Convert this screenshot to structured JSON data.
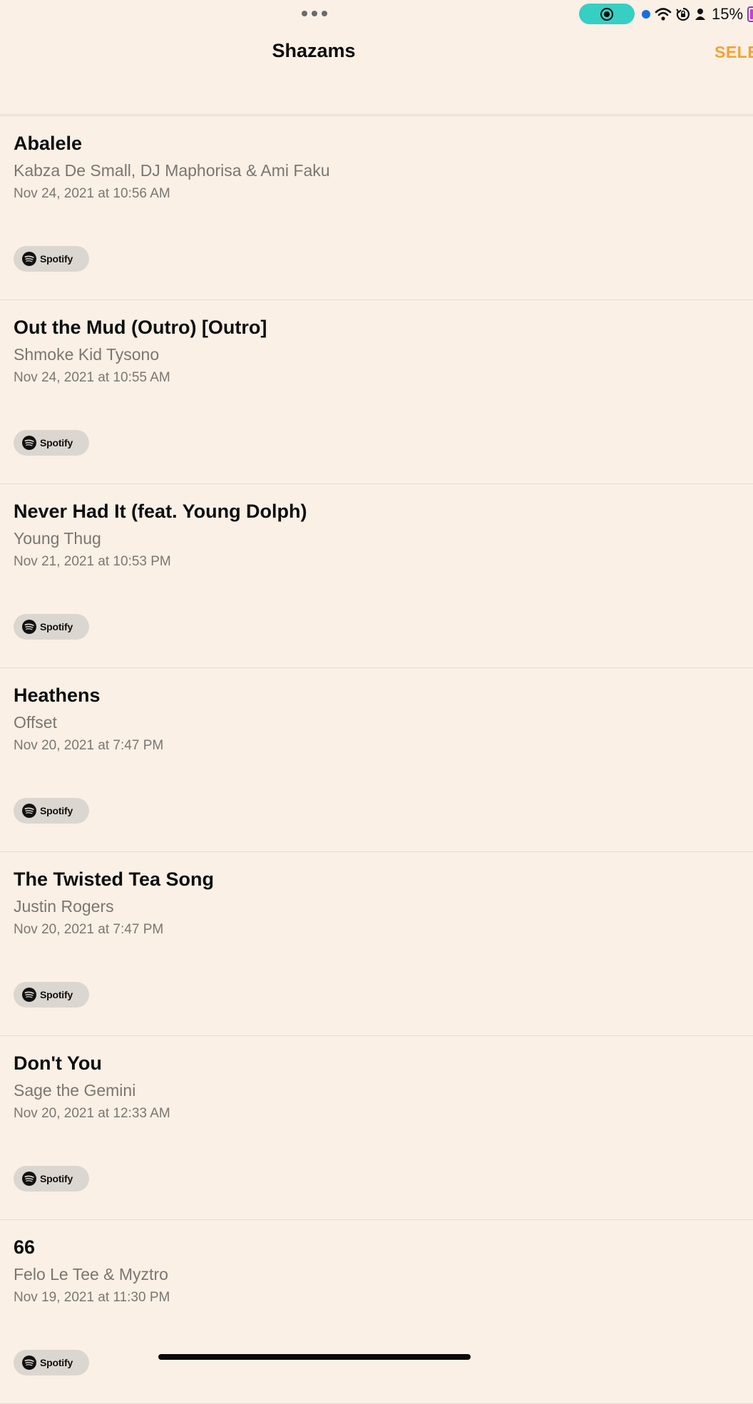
{
  "status_bar": {
    "battery_percent": "15%",
    "icons": [
      "multitask-dots-icon",
      "screen-record-icon",
      "location-dot-icon",
      "wifi-icon",
      "orientation-lock-icon",
      "person-icon",
      "battery-icon"
    ]
  },
  "nav": {
    "title": "Shazams",
    "select_label": "SELE"
  },
  "shazams": [
    {
      "title": "Abalele",
      "artist": "Kabza De Small, DJ Maphorisa & Ami Faku",
      "date": "Nov 24, 2021 at 10:56 AM",
      "button": "Spotify"
    },
    {
      "title": "Out the Mud (Outro) [Outro]",
      "artist": "Shmoke Kid Tysono",
      "date": "Nov 24, 2021 at 10:55 AM",
      "button": "Spotify"
    },
    {
      "title": "Never Had It (feat. Young Dolph)",
      "artist": "Young Thug",
      "date": "Nov 21, 2021 at 10:53 PM",
      "button": "Spotify"
    },
    {
      "title": "Heathens",
      "artist": "Offset",
      "date": "Nov 20, 2021 at 7:47 PM",
      "button": "Spotify"
    },
    {
      "title": "The Twisted Tea Song",
      "artist": "Justin Rogers",
      "date": "Nov 20, 2021 at 7:47 PM",
      "button": "Spotify"
    },
    {
      "title": "Don't You",
      "artist": "Sage the Gemini",
      "date": "Nov 20, 2021 at 12:33 AM",
      "button": "Spotify"
    },
    {
      "title": "66",
      "artist": "Felo Le Tee & Myztro",
      "date": "Nov 19, 2021 at 11:30 PM",
      "button": "Spotify"
    }
  ],
  "colors": {
    "background": "#faf0e6",
    "accent": "#f3a235",
    "record_pill": "#36cfc3",
    "secondary_text": "#7b7672"
  }
}
